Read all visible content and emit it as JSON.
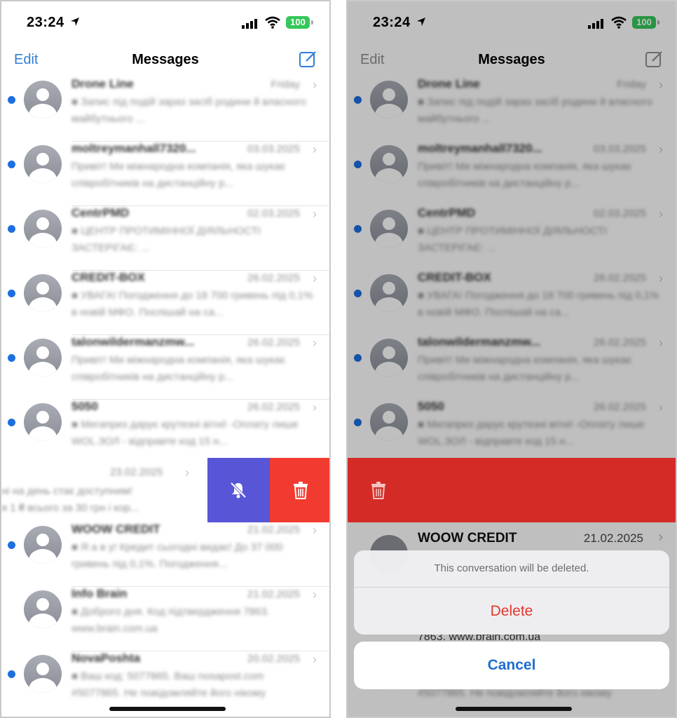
{
  "status": {
    "time": "23:24",
    "battery": "100"
  },
  "nav": {
    "edit": "Edit",
    "title": "Messages"
  },
  "rows": [
    {
      "name": "Drone Line",
      "date": "Friday",
      "preview": "■ Запис під подій зараз засіб родини й власного майбутнього ...",
      "unread": true
    },
    {
      "name": "moltreymanhall7320...",
      "date": "03.03.2025",
      "preview": "Привіт! Ми міжнародна компанія, яка шукає співробітників на дистанційну р...",
      "unread": true
    },
    {
      "name": "CentrPMD",
      "date": "02.03.2025",
      "preview": "■ ЦЕНТР ПРОТИМІННОЇ ДІЯЛЬНОСТІ ЗАСТЕРІГАЄ: ...",
      "unread": true
    },
    {
      "name": "CREDIT-BOX",
      "date": "26.02.2025",
      "preview": "■ УВАГА! Погодження до 18 700 гривень під 0,1% в новій МФО. Поспішай на са...",
      "unread": true
    },
    {
      "name": "talonwildermanzmw...",
      "date": "26.02.2025",
      "preview": "Привіт! Ми міжнародна компанія, яка шукає співробітників на дистанційну р...",
      "unread": true
    },
    {
      "name": "5050",
      "date": "26.02.2025",
      "preview": "■ Мегаприз дарує крутезні вітні! -Оплату лише WOL.ЗОЛ - відправте код 15 н...",
      "unread": true
    },
    {
      "name": "",
      "date": "",
      "preview": "",
      "unread": false
    },
    {
      "name": "WOOW CREDIT",
      "date": "21.02.2025",
      "preview": "■ Я а в у! Кредит сьогодні видає! До 37 000 гривень під 0,1%. Погодження...",
      "unread": true
    },
    {
      "name": "Info Brain",
      "date": "21.02.2025",
      "preview": "■ Доброго дня. Код підтвердження 7863. www.brain.com.ua",
      "unread": false
    },
    {
      "name": "NovaPoshta",
      "date": "20.02.2025",
      "preview": "■ Ваш код: 5077865. Ваш nosapost.com #5077865. Не повідомляйте його нікому",
      "unread": true
    }
  ],
  "swiped": {
    "date": "23.02.2025",
    "line1": "ні на день стає доступним!",
    "line2": "я 1 ₴ всього за 30 грн і кор..."
  },
  "sheet": {
    "message": "This conversation will be deleted.",
    "delete": "Delete",
    "cancel": "Cancel",
    "woow_name": "WOOW CREDIT",
    "woow_date": "21.02.2025",
    "peek_text": "7863. www.brain.com.ua"
  },
  "icons": {
    "location": "location-arrow-icon",
    "signal": "cellular-signal-icon",
    "wifi": "wifi-icon",
    "compose": "compose-icon",
    "mute": "bell-slash-icon",
    "trash": "trash-icon"
  },
  "colors": {
    "accent": "#2f7ed8",
    "unread_dot": "#1d6fe0",
    "mute": "#5856d6",
    "delete": "#f23b30",
    "battery": "#34c759"
  }
}
